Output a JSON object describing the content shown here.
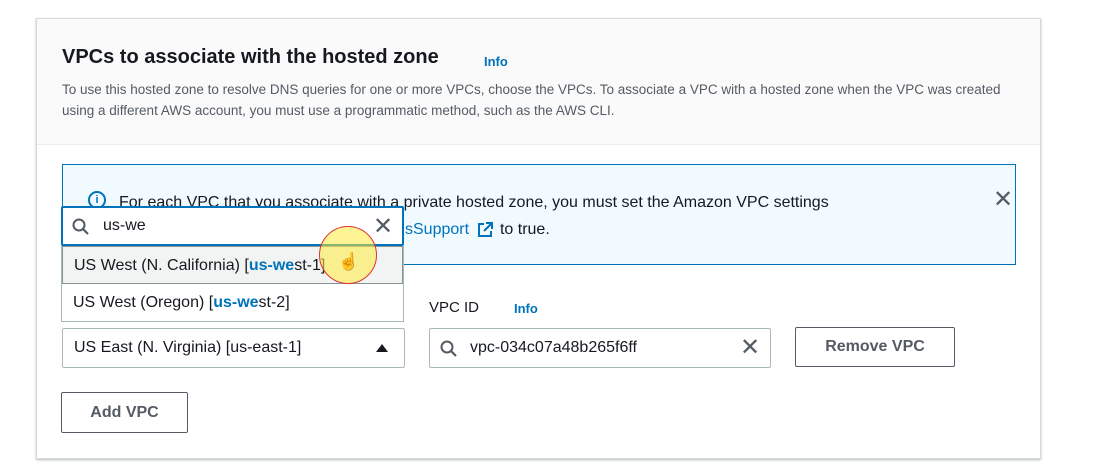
{
  "section": {
    "title": "VPCs to associate with the hosted zone",
    "info_label": "Info",
    "description": "To use this hosted zone to resolve DNS queries for one or more VPCs, choose the VPCs. To associate a VPC with a hosted zone when the VPC was created using a different AWS account, you must use a programmatic method, such as the AWS CLI."
  },
  "alert": {
    "icon": "info-icon",
    "text_before": "For each VPC that you associate with a private hosted zone, you must set the Amazon VPC settings",
    "link_text": "sSupport",
    "text_after": "to true.",
    "close_icon": "close-icon"
  },
  "region_select": {
    "selected": "US East (N. Virginia) [us-east-1]",
    "search_value": "us-we",
    "options": [
      {
        "name": "US West (N. California) [",
        "match": "us-we",
        "rest": "st-1]"
      },
      {
        "name": "US West (Oregon) [",
        "match": "us-we",
        "rest": "st-2]"
      }
    ]
  },
  "vpc_id": {
    "label": "VPC ID",
    "info_label": "Info",
    "value": "vpc-034c07a48b265f6ff"
  },
  "buttons": {
    "remove": "Remove VPC",
    "add": "Add VPC"
  },
  "colors": {
    "accent": "#0073bb",
    "alert_bg": "#f1faff",
    "text": "#16191f",
    "muted": "#545b64"
  }
}
